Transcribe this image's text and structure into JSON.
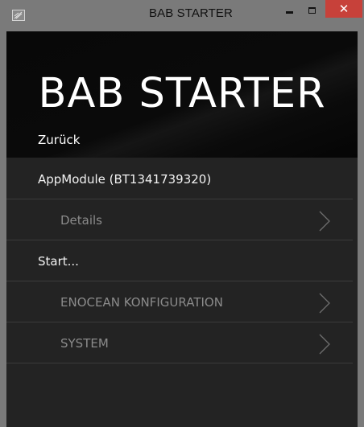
{
  "window": {
    "title": "BAB STARTER",
    "controls": {
      "minimize_icon": "minimize-icon",
      "maximize_icon": "maximize-icon",
      "close_glyph": "✕"
    }
  },
  "header": {
    "title": "BAB STARTER",
    "back_label": "Zurück"
  },
  "menu": {
    "items": [
      {
        "label": "AppModule (BT1341739320)",
        "kind": "main",
        "chevron": false
      },
      {
        "label": "Details",
        "kind": "sub",
        "chevron": true
      },
      {
        "label": "Start...",
        "kind": "main",
        "chevron": false
      },
      {
        "label": "ENOCEAN KONFIGURATION",
        "kind": "sub",
        "chevron": true
      },
      {
        "label": "SYSTEM",
        "kind": "sub",
        "chevron": true
      }
    ]
  },
  "colors": {
    "content_bg": "#232323",
    "header_bg": "#0a0a0a",
    "titlebar_bg": "#7a7a7a",
    "close_bg": "#c7413a",
    "main_text": "#f2f2f2",
    "sub_text": "#8b8b8b",
    "divider": "#3b3b3b"
  }
}
